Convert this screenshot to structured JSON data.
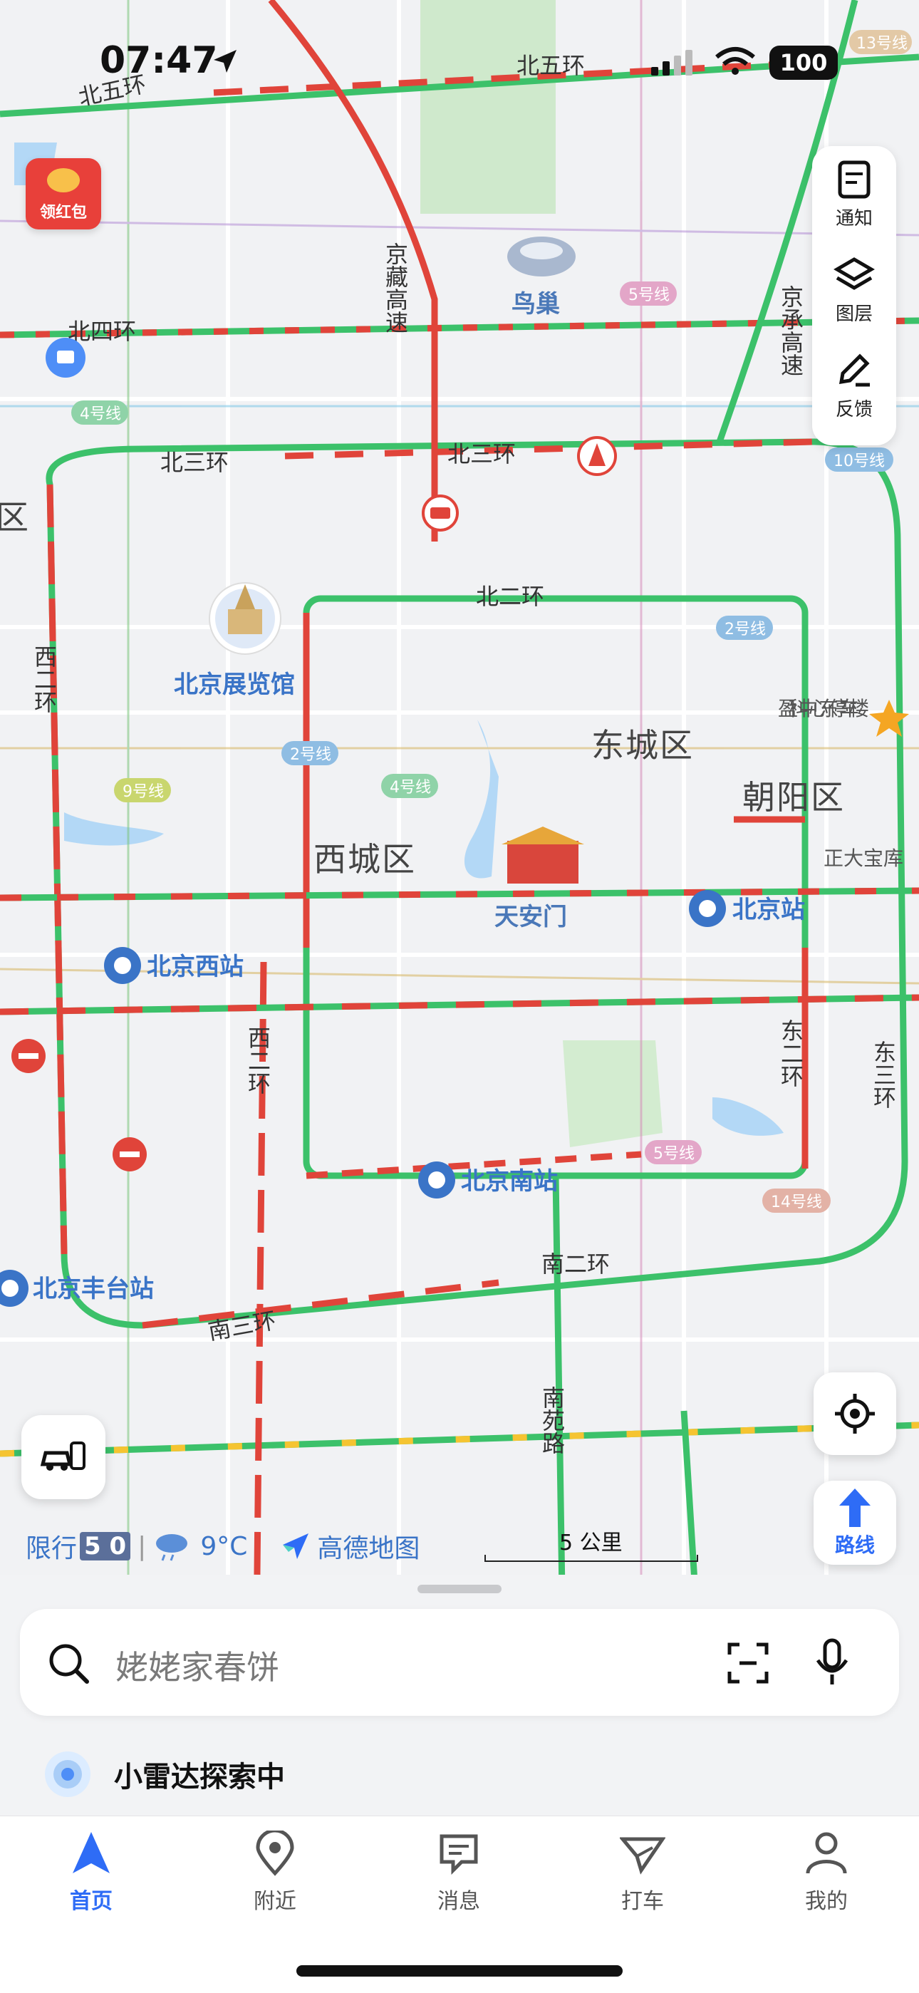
{
  "status_bar": {
    "time": "07:47",
    "battery": "100"
  },
  "map": {
    "roads": {
      "north5": "北五环",
      "north5_left": "北五环",
      "north4": "北四环",
      "north3": "北三环",
      "north3_right": "北三环",
      "north2": "北二环",
      "west2": "西二环",
      "west2_lower": "西二环",
      "east2": "东二环",
      "east3": "东三环",
      "south2": "南二环",
      "south3": "南三环",
      "jingzang": "京藏高速",
      "jingcheng": "京承高速",
      "nanyuan": "南苑路"
    },
    "districts": {
      "dongcheng": "东城区",
      "xicheng": "西城区",
      "chaoyang": "朝阳区",
      "haidian_partial": "区"
    },
    "pois": {
      "bird_nest": "鸟巢",
      "exhibition": "北京展览馆",
      "tiananmen": "天安门",
      "beijing_station": "北京站",
      "west_station": "北京西站",
      "south_station": "北京南站",
      "fengtai_station": "北京丰台站",
      "yingke": "盈科中心东停车楼",
      "zhengda": "正大宝库"
    },
    "metro_badges": [
      "4号线",
      "5号线",
      "10号线",
      "2号线",
      "9号线",
      "4号线",
      "2号线",
      "5号线",
      "14号线",
      "13号线"
    ],
    "red_packet": "领红包"
  },
  "side_panel": {
    "notice": "通知",
    "layers": "图层",
    "feedback": "反馈"
  },
  "route_button": "路线",
  "info_bar": {
    "restriction": "限行",
    "plate": "5 0",
    "temperature": "9°C",
    "brand": "高德地图"
  },
  "scale": "5 公里",
  "search": {
    "placeholder": "姥姥家春饼"
  },
  "radar": {
    "text": "小雷达探索中"
  },
  "tabs": [
    {
      "label": "首页"
    },
    {
      "label": "附近"
    },
    {
      "label": "消息"
    },
    {
      "label": "打车"
    },
    {
      "label": "我的"
    }
  ],
  "colors": {
    "accent": "#2e6cf6",
    "traffic_green": "#3cc16a",
    "traffic_red": "#e0443a",
    "traffic_yellow": "#f5c431"
  }
}
